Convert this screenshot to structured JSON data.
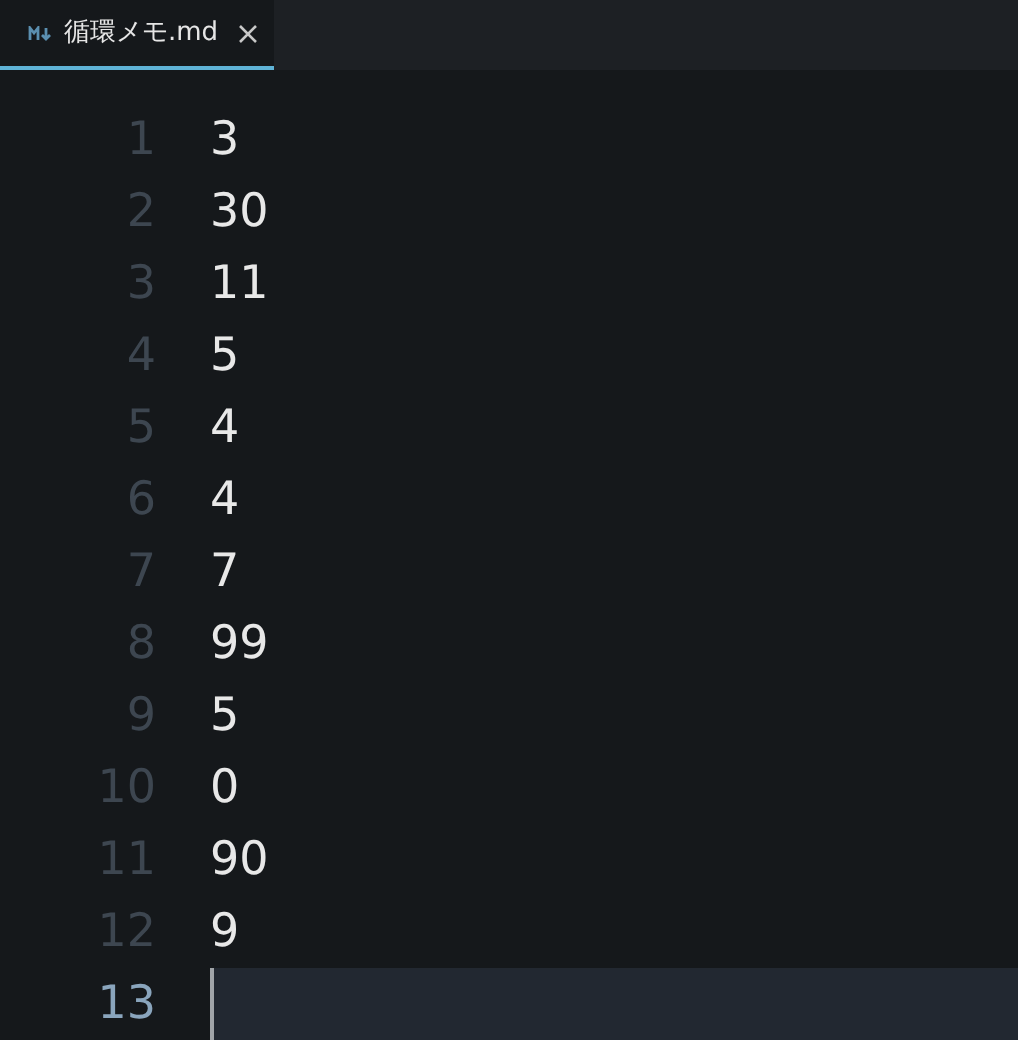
{
  "tabs": [
    {
      "title": "循環メモ.md",
      "selected": true
    }
  ],
  "editor": {
    "lines": [
      {
        "number": "1",
        "text": "3",
        "current": false
      },
      {
        "number": "2",
        "text": "30",
        "current": false
      },
      {
        "number": "3",
        "text": "11",
        "current": false
      },
      {
        "number": "4",
        "text": "5",
        "current": false
      },
      {
        "number": "5",
        "text": "4",
        "current": false
      },
      {
        "number": "6",
        "text": "4",
        "current": false
      },
      {
        "number": "7",
        "text": "7",
        "current": false
      },
      {
        "number": "8",
        "text": "99",
        "current": false
      },
      {
        "number": "9",
        "text": "5",
        "current": false
      },
      {
        "number": "10",
        "text": "0",
        "current": false
      },
      {
        "number": "11",
        "text": "90",
        "current": false
      },
      {
        "number": "12",
        "text": "9",
        "current": false
      },
      {
        "number": "13",
        "current": true
      }
    ]
  }
}
